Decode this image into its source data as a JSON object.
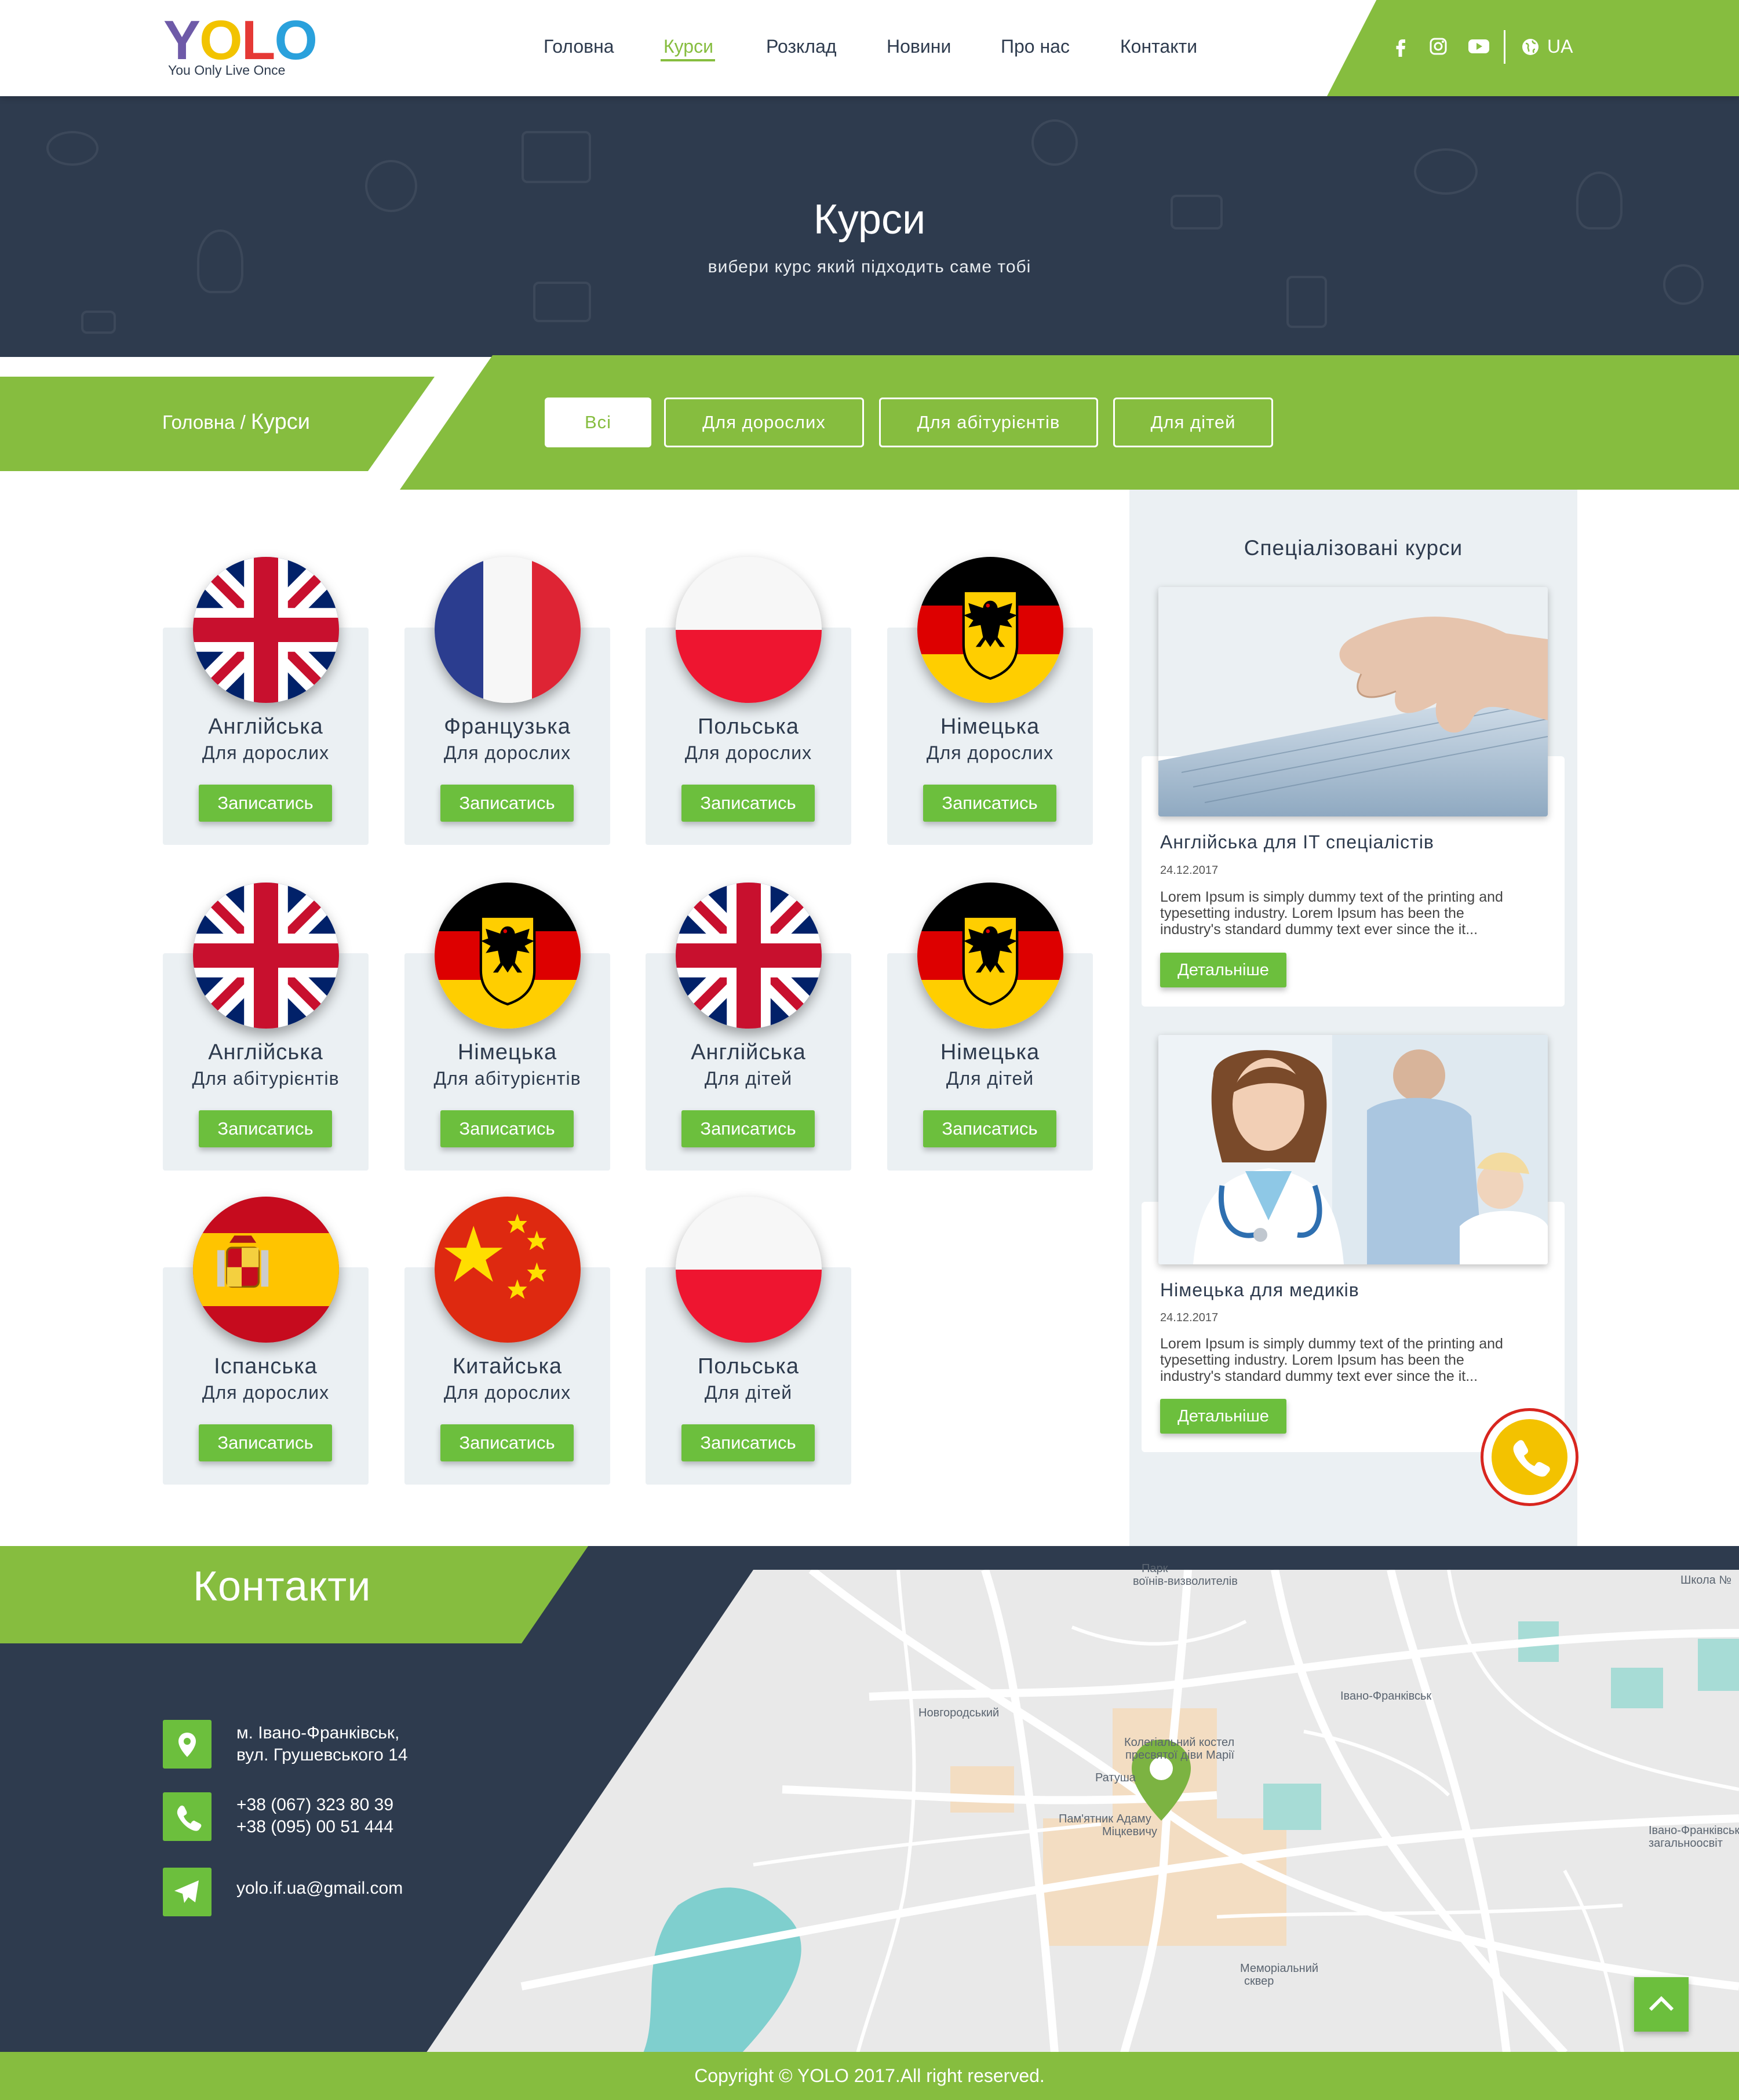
{
  "logo": {
    "text": "YOLO",
    "tagline": "You Only Live Once",
    "letter_colors": [
      "#6e5aa8",
      "#f2c300",
      "#e53935",
      "#2aa1dc"
    ]
  },
  "nav": {
    "items": [
      {
        "label": "Головна",
        "active": false
      },
      {
        "label": "Курси",
        "active": true
      },
      {
        "label": "Розклад",
        "active": false
      },
      {
        "label": "Новини",
        "active": false
      },
      {
        "label": "Про нас",
        "active": false
      },
      {
        "label": "Контакти",
        "active": false
      }
    ],
    "social_icons": [
      "facebook-icon",
      "instagram-icon",
      "youtube-icon"
    ],
    "language": "UA"
  },
  "hero": {
    "title": "Курси",
    "subtitle": "вибери курс який підходить саме тобі"
  },
  "breadcrumb": {
    "home": "Головна",
    "separator": "/",
    "current": "Курси"
  },
  "filters": [
    {
      "label": "Всі",
      "active": true
    },
    {
      "label": "Для дорослих",
      "active": false
    },
    {
      "label": "Для абітурієнтів",
      "active": false
    },
    {
      "label": "Для дітей",
      "active": false
    }
  ],
  "courses": [
    {
      "language": "Англійська",
      "category": "Для дорослих",
      "flag": "uk",
      "button": "Записатись"
    },
    {
      "language": "Французька",
      "category": "Для дорослих",
      "flag": "fr",
      "button": "Записатись"
    },
    {
      "language": "Польська",
      "category": "Для дорослих",
      "flag": "pl",
      "button": "Записатись"
    },
    {
      "language": "Німецька",
      "category": "Для дорослих",
      "flag": "de",
      "button": "Записатись"
    },
    {
      "language": "Англійська",
      "category": "Для абітурієнтів",
      "flag": "uk",
      "button": "Записатись"
    },
    {
      "language": "Німецька",
      "category": "Для абітурієнтів",
      "flag": "de",
      "button": "Записатись"
    },
    {
      "language": "Англійська",
      "category": "Для дітей",
      "flag": "uk",
      "button": "Записатись"
    },
    {
      "language": "Німецька",
      "category": "Для дітей",
      "flag": "de",
      "button": "Записатись"
    },
    {
      "language": "Іспанська",
      "category": "Для дорослих",
      "flag": "es",
      "button": "Записатись"
    },
    {
      "language": "Китайська",
      "category": "Для дорослих",
      "flag": "cn",
      "button": "Записатись"
    },
    {
      "language": "Польська",
      "category": "Для дітей",
      "flag": "pl",
      "button": "Записатись"
    }
  ],
  "sidebar": {
    "title": "Спеціалізовані курси",
    "cards": [
      {
        "title": "Англійська для IT спеціалістів",
        "date": "24.12.2017",
        "text_lines": [
          "Lorem Ipsum is simply dummy text of the printing and",
          "typesetting industry. Lorem Ipsum has been the",
          "industry's standard dummy text ever since the it..."
        ],
        "button": "Детальніше",
        "image": "laptop-typing"
      },
      {
        "title": "Німецька для медиків",
        "date": "24.12.2017",
        "text_lines": [
          "Lorem Ipsum is simply dummy text of the printing and",
          "typesetting industry. Lorem Ipsum has been the",
          "industry's standard dummy text ever since the it..."
        ],
        "button": "Детальніше",
        "image": "doctor"
      }
    ]
  },
  "contacts": {
    "title": "Контакти",
    "address": [
      "м. Івано-Франківськ,",
      "вул. Грушевського 14"
    ],
    "phones": [
      "+38 (067) 323 80 39",
      "+38 (095) 00 51 444"
    ],
    "email": "yolo.if.ua@gmail.com"
  },
  "map": {
    "labels": [
      "Парк",
      "воїнів-визволителів",
      "Школа №",
      "Новгородський",
      "Колегіальний костел",
      "пресвятої діви Марії",
      "Ратуша",
      "Пам'ятник Адаму",
      "Міцкевичу",
      "Івано-Франківськ",
      "Івано-Франківськ",
      "загальноосвіт",
      "Меморіальний",
      "сквер"
    ]
  },
  "footer": {
    "copyright": "Copyright © YOLO 2017.All right reserved."
  },
  "colors": {
    "green": "#86bd3f",
    "button_green": "#6cbf3d",
    "navy": "#2e3b4e",
    "card_bg": "#ebf0f3"
  }
}
